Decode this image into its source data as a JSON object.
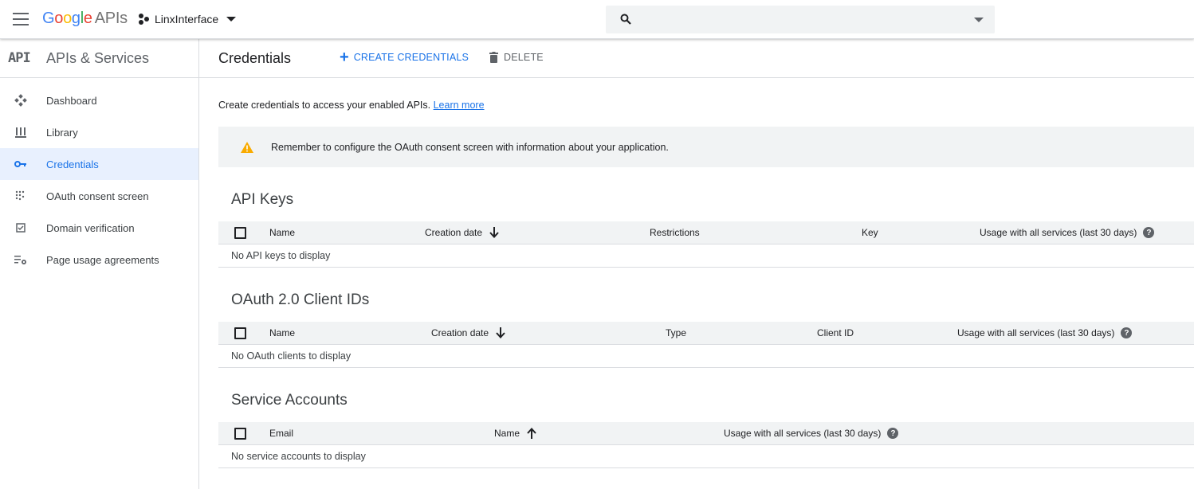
{
  "header": {
    "logo_letters": [
      "G",
      "o",
      "o",
      "g",
      "l",
      "e"
    ],
    "logo_suffix": "APIs",
    "project_name": "LinxInterface",
    "search_placeholder": ""
  },
  "sidebar": {
    "logo_text": "API",
    "title": "APIs & Services",
    "items": [
      {
        "label": "Dashboard",
        "icon": "dashboard-icon",
        "active": false
      },
      {
        "label": "Library",
        "icon": "library-icon",
        "active": false
      },
      {
        "label": "Credentials",
        "icon": "key-icon",
        "active": true
      },
      {
        "label": "OAuth consent screen",
        "icon": "oauth-consent-icon",
        "active": false
      },
      {
        "label": "Domain verification",
        "icon": "checkbox-icon",
        "active": false
      },
      {
        "label": "Page usage agreements",
        "icon": "settings-list-icon",
        "active": false
      }
    ]
  },
  "toolbar": {
    "title": "Credentials",
    "create_label": "CREATE CREDENTIALS",
    "delete_label": "DELETE"
  },
  "intro": {
    "text": "Create credentials to access your enabled APIs.",
    "link": "Learn more"
  },
  "notice": {
    "text": "Remember to configure the OAuth consent screen with information about your application."
  },
  "api_keys": {
    "title": "API Keys",
    "columns": [
      "Name",
      "Creation date",
      "Restrictions",
      "Key",
      "Usage with all services (last 30 days)"
    ],
    "empty": "No API keys to display"
  },
  "oauth": {
    "title": "OAuth 2.0 Client IDs",
    "columns": [
      "Name",
      "Creation date",
      "Type",
      "Client ID",
      "Usage with all services (last 30 days)"
    ],
    "empty": "No OAuth clients to display"
  },
  "service_accounts": {
    "title": "Service Accounts",
    "columns": [
      "Email",
      "Name",
      "Usage with all services (last 30 days)"
    ],
    "empty": "No service accounts to display"
  },
  "colors": {
    "accent": "#1a73e8",
    "warning": "#f9ab00",
    "active_bg": "#e8f0fe"
  }
}
